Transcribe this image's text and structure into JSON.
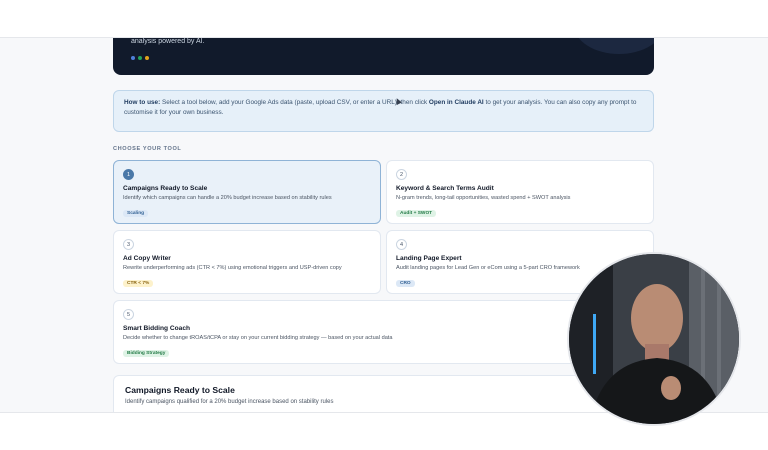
{
  "hero": {
    "subtitle": "analysis powered by AI.",
    "dot_colors": [
      "#4f7fd8",
      "#22a35a",
      "#e2a21c"
    ]
  },
  "howto": {
    "lead": "How to use:",
    "text_a": " Select a tool below, add your Google Ads data (paste, upload CSV, or enter a URL), then click ",
    "action": "Open in Claude AI",
    "text_b": " to get your analysis. You can also copy any prompt to customise it for your own business."
  },
  "section_label": "CHOOSE YOUR TOOL",
  "tools": [
    {
      "num": "1",
      "title": "Campaigns Ready to Scale",
      "desc": "Identify which campaigns can handle a 20% budget increase based on stability rules",
      "tag": "Scaling",
      "selected": true
    },
    {
      "num": "2",
      "title": "Keyword & Search Terms Audit",
      "desc": "N-gram trends, long-tail opportunities, wasted spend + SWOT analysis",
      "tag": "Audit + SWOT",
      "selected": false
    },
    {
      "num": "3",
      "title": "Ad Copy Writer",
      "desc": "Rewrite underperforming ads (CTR < 7%) using emotional triggers and USP-driven copy",
      "tag": "CTR < 7%",
      "selected": false
    },
    {
      "num": "4",
      "title": "Landing Page Expert",
      "desc": "Audit landing pages for Lead Gen or eCom using a 5-part CRO framework",
      "tag": "CRO",
      "selected": false
    },
    {
      "num": "5",
      "title": "Smart Bidding Coach",
      "desc": "Decide whether to change tROAS/tCPA or stay on your current bidding strategy — based on your actual data",
      "tag": "Bidding Strategy",
      "selected": false
    }
  ],
  "detail": {
    "title": "Campaigns Ready to Scale",
    "subtitle": "Identify campaigns qualified for a 20% budget increase based on stability rules"
  },
  "colors": {
    "selected_border": "#8fb3d6",
    "selected_bg": "#e9f1f9",
    "hero_bg": "#111a2b",
    "howto_bg": "#e6f0f9"
  }
}
